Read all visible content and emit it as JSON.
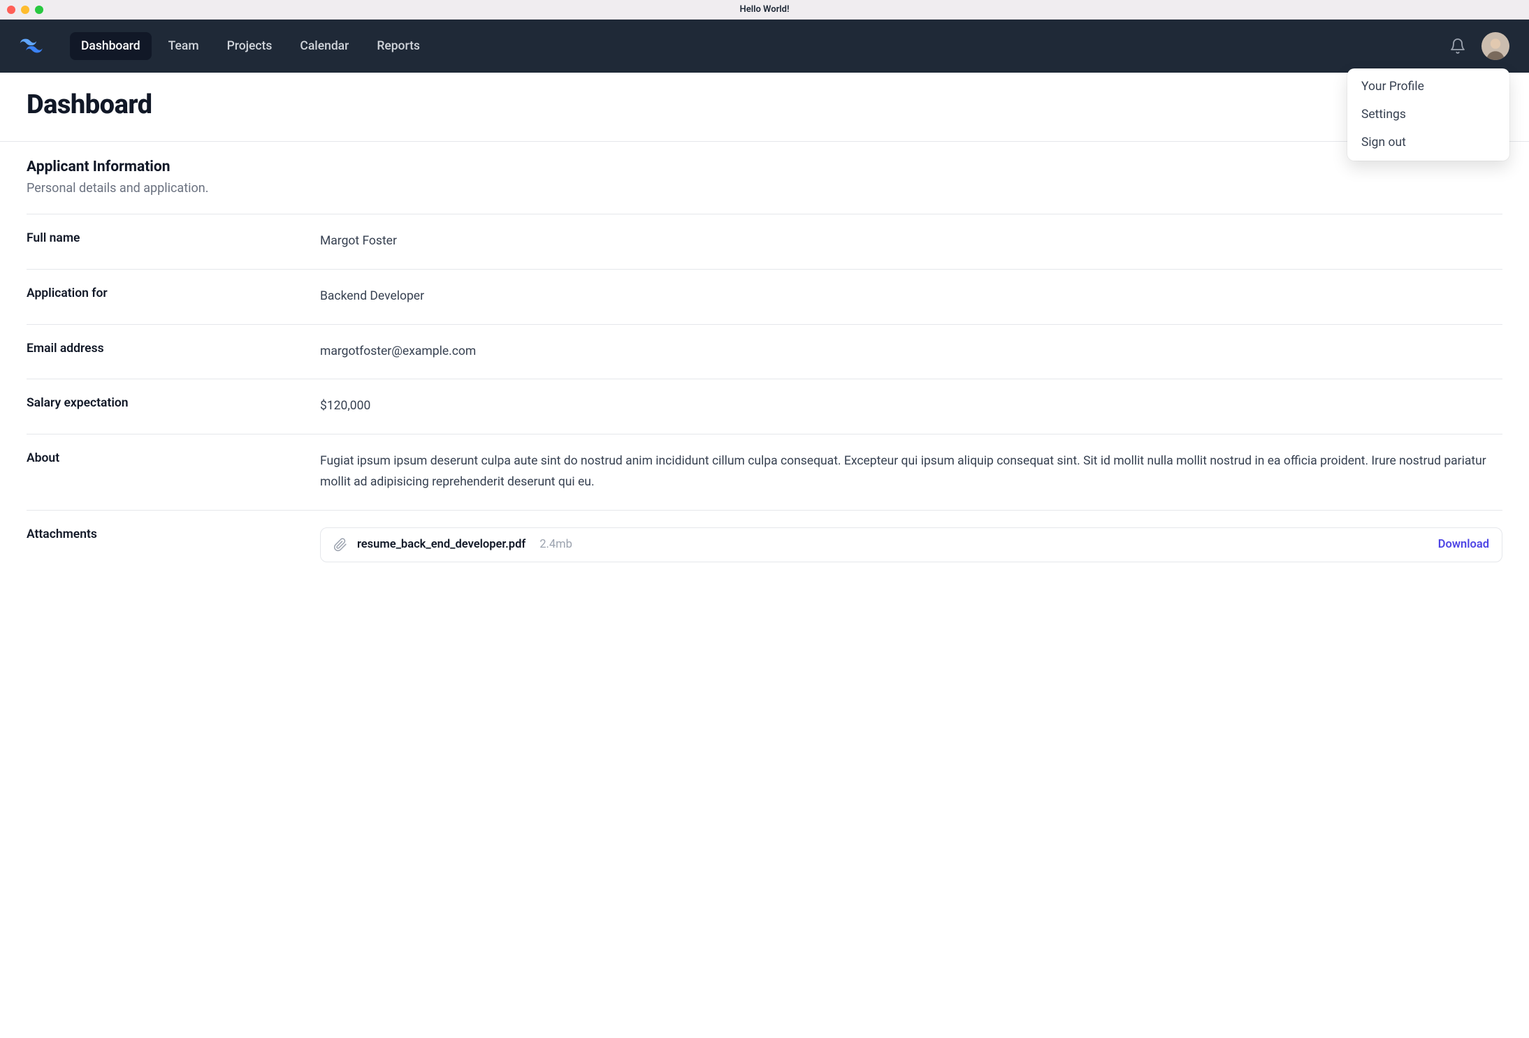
{
  "window": {
    "title": "Hello World!"
  },
  "nav": {
    "items": [
      {
        "label": "Dashboard",
        "active": true
      },
      {
        "label": "Team",
        "active": false
      },
      {
        "label": "Projects",
        "active": false
      },
      {
        "label": "Calendar",
        "active": false
      },
      {
        "label": "Reports",
        "active": false
      }
    ]
  },
  "dropdown": {
    "items": [
      {
        "label": "Your Profile"
      },
      {
        "label": "Settings"
      },
      {
        "label": "Sign out"
      }
    ]
  },
  "page": {
    "title": "Dashboard"
  },
  "applicant": {
    "section_title": "Applicant Information",
    "section_sub": "Personal details and application.",
    "fields": {
      "full_name_label": "Full name",
      "full_name_value": "Margot Foster",
      "application_for_label": "Application for",
      "application_for_value": "Backend Developer",
      "email_label": "Email address",
      "email_value": "margotfoster@example.com",
      "salary_label": "Salary expectation",
      "salary_value": "$120,000",
      "about_label": "About",
      "about_value": "Fugiat ipsum ipsum deserunt culpa aute sint do nostrud anim incididunt cillum culpa consequat. Excepteur qui ipsum aliquip consequat sint. Sit id mollit nulla mollit nostrud in ea officia proident. Irure nostrud pariatur mollit ad adipisicing reprehenderit deserunt qui eu.",
      "attachments_label": "Attachments"
    },
    "attachments": [
      {
        "name": "resume_back_end_developer.pdf",
        "size": "2.4mb",
        "download_label": "Download"
      }
    ]
  }
}
